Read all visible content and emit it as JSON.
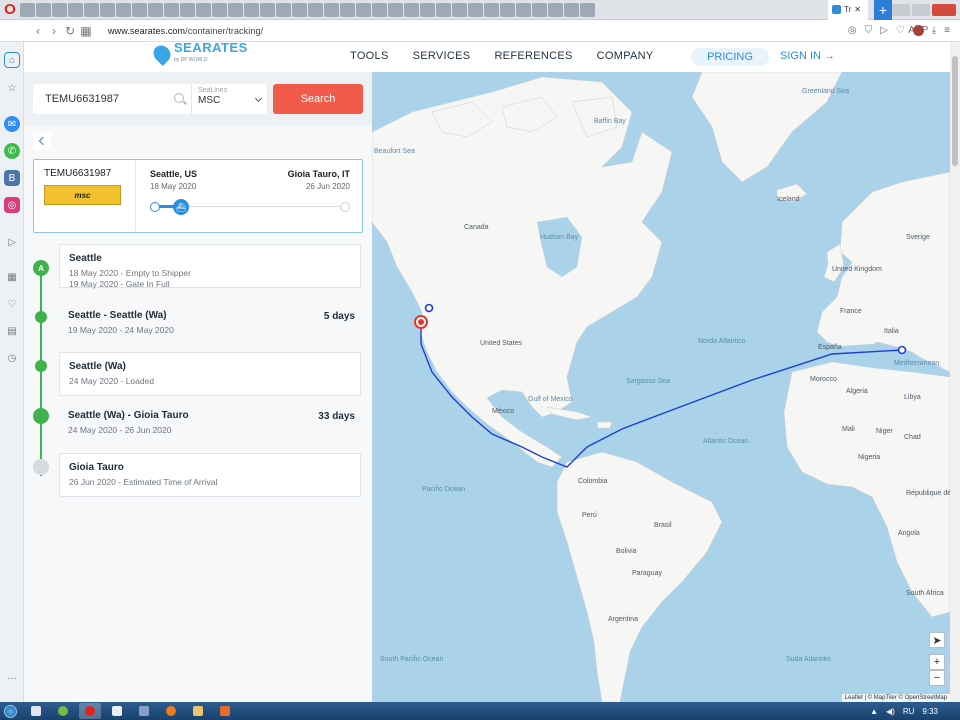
{
  "browser": {
    "active_tab_title": "Tr",
    "url_host": "www.searates.com",
    "url_path": "/container/tracking/"
  },
  "site": {
    "logo_text": "SEARATES",
    "logo_sub": "by DP WORLD",
    "nav": [
      "TOOLS",
      "SERVICES",
      "REFERENCES",
      "COMPANY"
    ],
    "pricing": "PRICING",
    "sign_in": "SIGN IN →"
  },
  "search": {
    "container_value": "TEMU6631987",
    "sealine_label": "SeaLines",
    "sealine_value": "MSC",
    "button": "Search"
  },
  "container": {
    "number": "TEMU6631987",
    "carrier": "msc",
    "from": "Seattle, US",
    "from_date": "18 May 2020",
    "to": "Gioia Tauro, IT",
    "to_date": "26 Jun 2020",
    "progress": 0.12
  },
  "timeline": [
    {
      "badge": "A",
      "title": "Seattle",
      "lines": [
        "18 May 2020 - Empty to Shipper",
        "19 May 2020 - Gate In Full"
      ],
      "duration": "",
      "status": "done",
      "boxed": true
    },
    {
      "badge": "",
      "title": "Seattle - Seattle (Wa)",
      "lines": [
        "19 May 2020 - 24 May 2020"
      ],
      "duration": "5 days",
      "status": "done",
      "boxed": false
    },
    {
      "badge": "",
      "title": "Seattle (Wa)",
      "lines": [
        "24 May 2020 - Loaded"
      ],
      "duration": "",
      "status": "done",
      "boxed": true
    },
    {
      "badge": "",
      "title": "Seattle (Wa) - Gioia Tauro",
      "lines": [
        "24 May 2020 - 26 Jun 2020"
      ],
      "duration": "33 days",
      "status": "current",
      "boxed": false
    },
    {
      "badge": "",
      "title": "Gioia Tauro",
      "lines": [
        "26 Jun 2020 - Estimated Time of Arrival"
      ],
      "duration": "",
      "status": "pending",
      "boxed": true
    }
  ],
  "map": {
    "labels": [
      {
        "text": "Greenland Sea",
        "kind": "sea"
      },
      {
        "text": "Baffin Bay",
        "kind": "sea"
      },
      {
        "text": "Beaufort Sea",
        "kind": "sea"
      },
      {
        "text": "Canada",
        "kind": "land"
      },
      {
        "text": "Hudson Bay",
        "kind": "sea"
      },
      {
        "text": "Iceland",
        "kind": "land"
      },
      {
        "text": "United States",
        "kind": "land"
      },
      {
        "text": "Norda Atlantico",
        "kind": "sea"
      },
      {
        "text": "Sargasso Sea",
        "kind": "sea"
      },
      {
        "text": "Gulf of Mexico",
        "kind": "sea"
      },
      {
        "text": "México",
        "kind": "land"
      },
      {
        "text": "Atlantic Ocean",
        "kind": "sea"
      },
      {
        "text": "Pacific Ocean",
        "kind": "sea"
      },
      {
        "text": "Colombia",
        "kind": "land"
      },
      {
        "text": "Perú",
        "kind": "land"
      },
      {
        "text": "Brasil",
        "kind": "land"
      },
      {
        "text": "Bolivia",
        "kind": "land"
      },
      {
        "text": "Paraguay",
        "kind": "land"
      },
      {
        "text": "Argentina",
        "kind": "land"
      },
      {
        "text": "South Pacific Ocean",
        "kind": "sea"
      },
      {
        "text": "Suda Atlantiko",
        "kind": "sea"
      },
      {
        "text": "Sverige",
        "kind": "land"
      },
      {
        "text": "United Kingdom",
        "kind": "land"
      },
      {
        "text": "France",
        "kind": "land"
      },
      {
        "text": "España",
        "kind": "land"
      },
      {
        "text": "Italia",
        "kind": "land"
      },
      {
        "text": "Mediterranean",
        "kind": "sea"
      },
      {
        "text": "Morocco",
        "kind": "land"
      },
      {
        "text": "Algeria",
        "kind": "land"
      },
      {
        "text": "Libya",
        "kind": "land"
      },
      {
        "text": "Mali",
        "kind": "land"
      },
      {
        "text": "Niger",
        "kind": "land"
      },
      {
        "text": "Chad",
        "kind": "land"
      },
      {
        "text": "Nigeria",
        "kind": "land"
      },
      {
        "text": "Angola",
        "kind": "land"
      },
      {
        "text": "South Africa",
        "kind": "land"
      },
      {
        "text": "République démocratique du Congo",
        "kind": "land"
      }
    ],
    "zoom_in": "+",
    "zoom_out": "−",
    "attribution": "Leaflet | © MapTiler © OpenStreetMap",
    "route_color": "#1f3fd6"
  },
  "taskbar": {
    "lang": "RU",
    "time": "9:33"
  }
}
